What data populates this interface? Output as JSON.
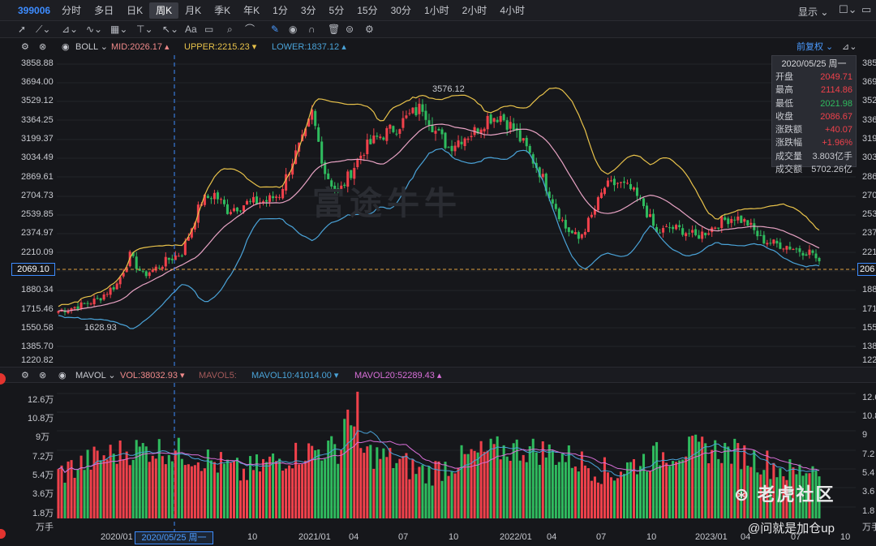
{
  "topbar": {
    "code": "399006",
    "periods": [
      "分时",
      "多日",
      "日K",
      "周K",
      "月K",
      "季K",
      "年K",
      "1分",
      "3分",
      "5分",
      "15分",
      "30分",
      "1小时",
      "2小时",
      "4小时"
    ],
    "active_period": "周K",
    "display": "显示"
  },
  "indicators": {
    "boll": "BOLL",
    "mid": "MID:2026.17",
    "upper": "UPPER:2215.23",
    "lower": "LOWER:1837.12",
    "adjust": "前复权"
  },
  "volume": {
    "mavol": "MAVOL",
    "vol": "VOL:38032.93",
    "mavol5": "MAVOL5:",
    "mavol10": "MAVOL10:41014.00",
    "mavol20": "MAVOL20:52289.43",
    "unit": "万手"
  },
  "price_axis_left": [
    "3858.88",
    "3694.00",
    "3529.12",
    "3364.25",
    "3199.37",
    "3034.49",
    "2869.61",
    "2704.73",
    "2539.85",
    "2374.97",
    "2210.09",
    "1880.34",
    "1715.46",
    "1550.58",
    "1385.70",
    "1220.82"
  ],
  "price_axis_right": [
    "385",
    "369",
    "352",
    "336",
    "319",
    "303",
    "286",
    "270",
    "253",
    "237",
    "221",
    "188",
    "171",
    "155",
    "138",
    "122"
  ],
  "vol_axis_left": [
    "12.6万",
    "10.8万",
    "9万",
    "7.2万",
    "5.4万",
    "3.6万",
    "1.8万"
  ],
  "vol_axis_right": [
    "12.6",
    "10.8",
    "9",
    "7.2",
    "5.4",
    "3.6",
    "1.8"
  ],
  "current_price": "2069.10",
  "current_price_right": "206",
  "crosshair_date": "2020/05/25 周一",
  "high_label": "3576.12",
  "low_label": "1628.93",
  "x_axis": [
    "2020/01",
    "10",
    "2021/01",
    "04",
    "07",
    "10",
    "2022/01",
    "04",
    "07",
    "10",
    "2023/01",
    "04",
    "07",
    "10"
  ],
  "info": {
    "date": "2020/05/25 周一",
    "rows": [
      {
        "k": "开盘",
        "v": "2049.71",
        "c": "red"
      },
      {
        "k": "最高",
        "v": "2114.86",
        "c": "red"
      },
      {
        "k": "最低",
        "v": "2021.98",
        "c": "green"
      },
      {
        "k": "收盘",
        "v": "2086.67",
        "c": "red"
      },
      {
        "k": "涨跌额",
        "v": "+40.07",
        "c": "red"
      },
      {
        "k": "涨跌幅",
        "v": "+1.96%",
        "c": "red"
      },
      {
        "k": "成交量",
        "v": "3.803亿手",
        "c": ""
      },
      {
        "k": "成交额",
        "v": "5702.26亿",
        "c": ""
      }
    ]
  },
  "watermark": "富途牛牛",
  "tiger": "老虎社区",
  "signature": "@问就是加仓up",
  "colors": {
    "up": "#f0414b",
    "down": "#2fbb5e",
    "upper": "#e8c24a",
    "mid": "#e8a3c4",
    "lower": "#4aa3d8",
    "mavol10": "#4aa3d8",
    "mavol20": "#d86fd8"
  }
}
